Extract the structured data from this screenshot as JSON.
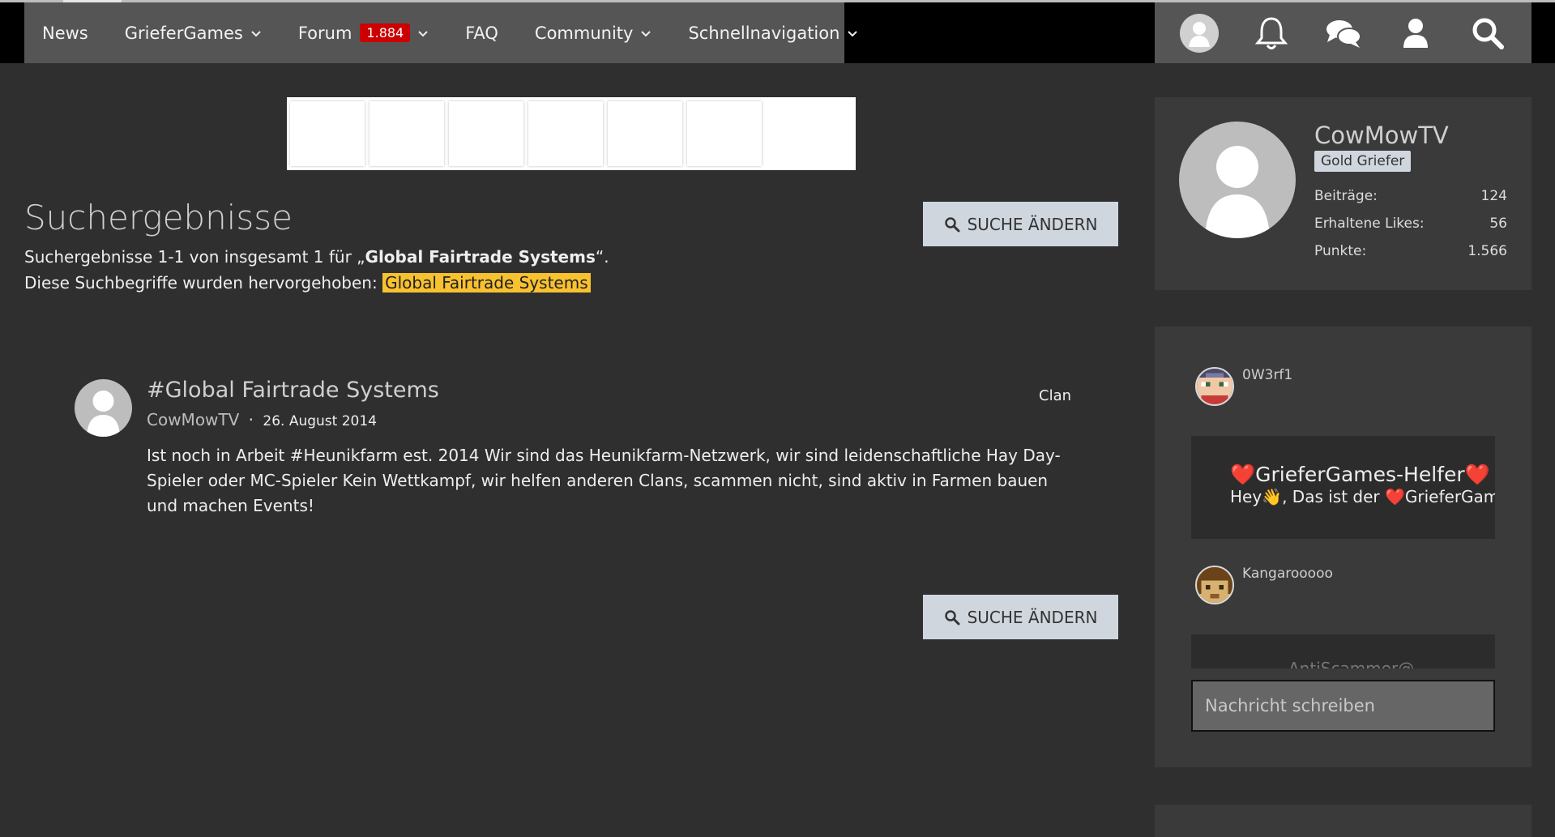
{
  "nav": {
    "items": [
      {
        "label": "News"
      },
      {
        "label": "GrieferGames"
      },
      {
        "label": "Forum",
        "badge": "1.884"
      },
      {
        "label": "FAQ"
      },
      {
        "label": "Community"
      },
      {
        "label": "Schnellnavigation"
      }
    ]
  },
  "page": {
    "title": "Suchergebnisse",
    "summary_prefix": "Suchergebnisse 1-1 von insgesamt 1 für „",
    "summary_term": "Global Fairtrade Systems",
    "summary_suffix": "“.",
    "highlight_prefix": "Diese Suchbegriffe wurden hervorgehoben: ",
    "highlight_term": "Global Fairtrade Systems",
    "change_search_label": "SUCHE ÄNDERN"
  },
  "result": {
    "title": "#Global Fairtrade Systems",
    "author": "CowMowTV",
    "separator": "·",
    "date": "26. August 2014",
    "tag": "Clan",
    "excerpt": "Ist noch in Arbeit #Heunikfarm est. 2014 Wir sind das Heunikfarm-Netzwerk, wir sind leidenschaftliche Hay Day-Spieler oder MC-Spieler Kein Wettkampf, wir helfen anderen Clans, scammen nicht, sind aktiv in Farmen bauen und machen Events!"
  },
  "profile": {
    "username": "CowMowTV",
    "rank": "Gold Griefer",
    "stats": [
      {
        "label": "Beiträge:",
        "value": "124"
      },
      {
        "label": "Erhaltene Likes:",
        "value": "56"
      },
      {
        "label": "Punkte:",
        "value": "1.566"
      }
    ]
  },
  "chat": {
    "messages": [
      {
        "author": "0W3rf1",
        "heading": "❤️GrieferGames-Helfer❤️",
        "text": "Hey👋, Das ist der ❤️GrieferGames-Helfer❤️"
      },
      {
        "author": "Kangarooooo",
        "heading": "",
        "text": "AntiScammer@...."
      }
    ],
    "input_placeholder": "Nachricht schreiben"
  },
  "colors": {
    "background": "#2f2f2f",
    "nav": "#555555",
    "highlight": "#f8c12f",
    "badge": "#cc0000",
    "button": "#cfd6de"
  }
}
